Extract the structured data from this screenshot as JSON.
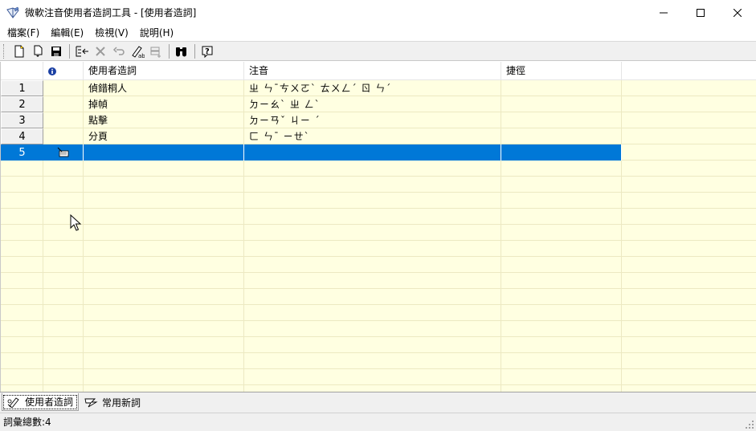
{
  "window": {
    "title": "微軟注音使用者造詞工具 - [使用者造詞]",
    "icon": "app-book-icon"
  },
  "menu": [
    {
      "label": "檔案(F)"
    },
    {
      "label": "編輯(E)"
    },
    {
      "label": "檢視(V)"
    },
    {
      "label": "說明(H)"
    }
  ],
  "toolbar": {
    "buttons": [
      "new-file-icon",
      "open-file-icon",
      "save-icon",
      "add-word-icon",
      "delete-icon",
      "undo-icon",
      "edit-word-icon",
      "insert-row-icon",
      "find-icon",
      "help-icon"
    ]
  },
  "grid": {
    "headers": {
      "info": "info-icon",
      "word": "使用者造詞",
      "zhuyin": "注音",
      "shortcut": "捷徑"
    },
    "rows": [
      {
        "num": "1",
        "word": "偵錯桐人",
        "zhuyin": "ㄓ ㄣˉㄘㄨㄛˋ ㄊㄨㄥˊ ㄖ ㄣˊ",
        "shortcut": ""
      },
      {
        "num": "2",
        "word": "掉幀",
        "zhuyin": "ㄉㄧㄠˋ ㄓ ㄥˋ",
        "shortcut": ""
      },
      {
        "num": "3",
        "word": "點擊",
        "zhuyin": "ㄉㄧㄢˇ ㄐㄧ ˊ",
        "shortcut": ""
      },
      {
        "num": "4",
        "word": "分頁",
        "zhuyin": "ㄈ ㄣˉ ㄧㄝˋ",
        "shortcut": ""
      },
      {
        "num": "5",
        "word": "",
        "zhuyin": "",
        "shortcut": ""
      }
    ]
  },
  "tabs": [
    {
      "label": "使用者造詞",
      "active": true
    },
    {
      "label": "常用新詞",
      "active": false
    }
  ],
  "status": {
    "text": "詞彙總數:4"
  },
  "colors": {
    "grid_background": "#ffffe1",
    "selection": "#0078d7",
    "chrome": "#f0f0f0"
  }
}
